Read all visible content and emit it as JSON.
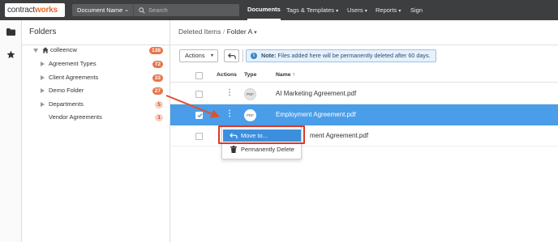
{
  "header": {
    "logo_prefix": "contract",
    "logo_suffix": "works",
    "search_scope": "Document Name",
    "search_placeholder": "Search",
    "nav": [
      "Documents",
      "Tags & Templates",
      "Users",
      "Reports",
      "Sign"
    ],
    "active_nav": "Documents"
  },
  "rail": {
    "items": [
      "folder-icon",
      "star-icon"
    ]
  },
  "folders": {
    "title": "Folders",
    "root": {
      "label": "colleencw",
      "count": "138"
    },
    "items": [
      {
        "label": "Agreement Types",
        "count": "72"
      },
      {
        "label": "Client Agreements",
        "count": "33"
      },
      {
        "label": "Demo Folder",
        "count": "27"
      },
      {
        "label": "Departments",
        "count": "5"
      },
      {
        "label": "Vendor Agreements",
        "count": "1"
      }
    ]
  },
  "breadcrumb": {
    "parent": "Deleted Items",
    "separator": "/",
    "current": "Folder A"
  },
  "toolbar": {
    "actions_label": "Actions",
    "note_bold": "Note:",
    "note_text": " Files added here will be permanently deleted after 60 days."
  },
  "table": {
    "columns": [
      "Actions",
      "Type",
      "Name"
    ],
    "sort_indicator": "↑",
    "rows": [
      {
        "type": "PDF",
        "name": "AI Marketing Agreement.pdf",
        "selected": false
      },
      {
        "type": "PDF",
        "name": "Employment Agreement.pdf",
        "selected": true
      },
      {
        "type": "",
        "name": "ment Agreement.pdf",
        "selected": false
      }
    ]
  },
  "context_menu": {
    "items": [
      {
        "label": "Move to...",
        "icon": "undo-arrow-icon",
        "highlighted": true
      },
      {
        "label": "Permanently Delete",
        "icon": "trash-icon",
        "highlighted": false
      }
    ]
  },
  "colors": {
    "topbar": "#3d3e40",
    "accent_orange": "#e46a2a",
    "selected_row": "#4a9de8",
    "annotation_red": "#d93a2b"
  }
}
